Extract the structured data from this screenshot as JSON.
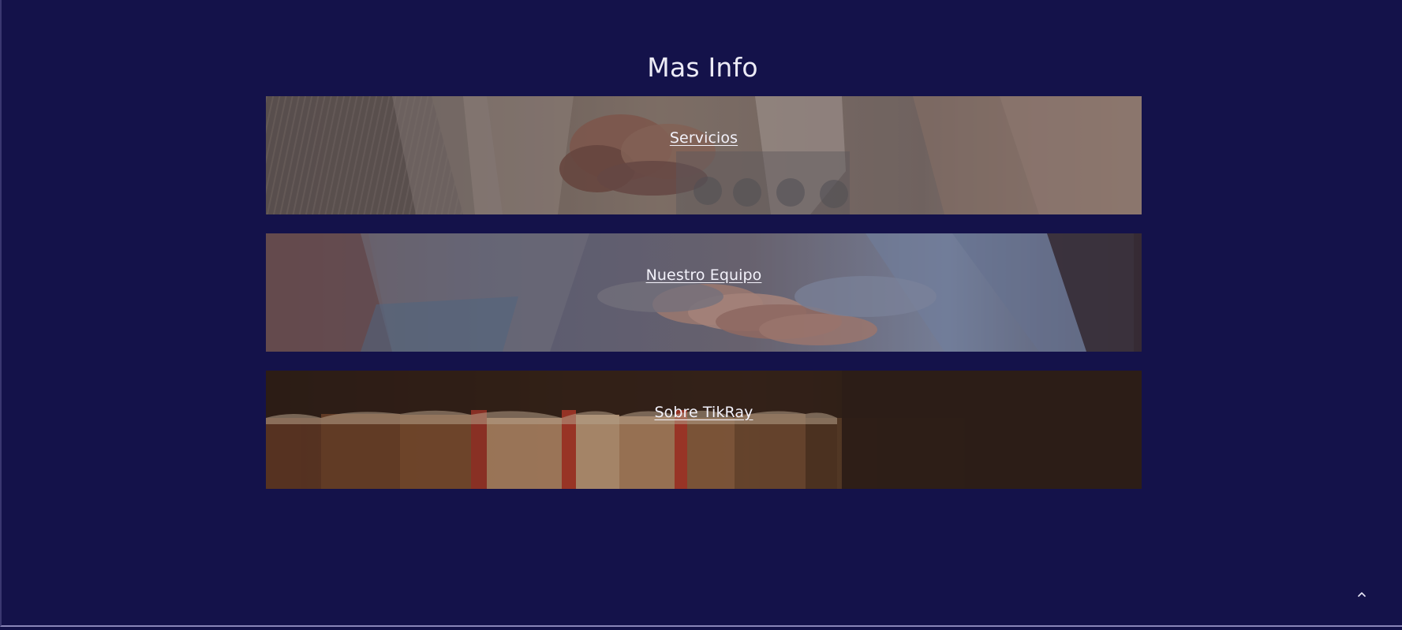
{
  "section": {
    "title": "Mas Info"
  },
  "banners": [
    {
      "label": "Servicios",
      "image": "handshake-photo"
    },
    {
      "label": "Nuestro Equipo",
      "image": "team-hands-photo"
    },
    {
      "label": "Sobre TikRay",
      "image": "books-photo"
    }
  ],
  "controls": {
    "scroll_top_icon": "chevron-up-icon"
  },
  "colors": {
    "background": "#14124a",
    "text": "#ecebf6"
  }
}
